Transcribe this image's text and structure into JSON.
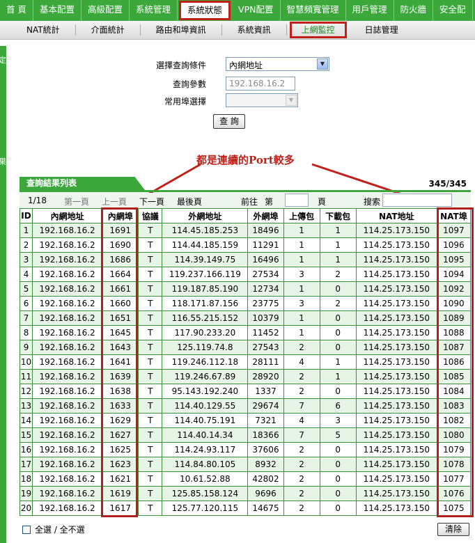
{
  "topnav": [
    "首 頁",
    "基本配置",
    "高級配置",
    "系統管理",
    "系統狀態",
    "VPN配置",
    "智慧頻寬管理",
    "用戶管理",
    "防火牆",
    "安全配"
  ],
  "subnav": [
    "NAT統計",
    "介面統計",
    "路由和埠資訊",
    "系統資訊",
    "上網監控",
    "日誌管理"
  ],
  "leftbar": {
    "top_char": "定",
    "mid_char": "果"
  },
  "query": {
    "cond_label": "選擇查詢條件",
    "cond_value": "內網地址",
    "param_label": "查詢參數",
    "param_value": "192.168.16.2",
    "port_label": "常用埠選擇",
    "port_value": "",
    "button": "查 詢"
  },
  "annotation": "都是連續的Port較多",
  "results": {
    "title": "查詢結果列表",
    "count": "345/345",
    "pager": {
      "page": "1/18",
      "first": "第一頁",
      "prev": "上一頁",
      "next": "下一頁",
      "last": "最後頁",
      "goto": "前往",
      "di": "第",
      "ye": "頁",
      "search": "搜索"
    },
    "columns": [
      "ID",
      "內網地址",
      "內網埠",
      "協議",
      "外網地址",
      "外網埠",
      "上傳包",
      "下載包",
      "NAT地址",
      "NAT埠"
    ],
    "rows": [
      [
        "1",
        "192.168.16.2",
        "1691",
        "T",
        "114.45.185.253",
        "18496",
        "1",
        "1",
        "114.25.173.150",
        "1097"
      ],
      [
        "2",
        "192.168.16.2",
        "1690",
        "T",
        "114.44.185.159",
        "11291",
        "1",
        "1",
        "114.25.173.150",
        "1096"
      ],
      [
        "3",
        "192.168.16.2",
        "1686",
        "T",
        "114.39.149.75",
        "16496",
        "1",
        "1",
        "114.25.173.150",
        "1095"
      ],
      [
        "4",
        "192.168.16.2",
        "1664",
        "T",
        "119.237.166.119",
        "27534",
        "3",
        "2",
        "114.25.173.150",
        "1094"
      ],
      [
        "5",
        "192.168.16.2",
        "1661",
        "T",
        "119.187.85.190",
        "12734",
        "1",
        "0",
        "114.25.173.150",
        "1092"
      ],
      [
        "6",
        "192.168.16.2",
        "1660",
        "T",
        "118.171.87.156",
        "23775",
        "3",
        "2",
        "114.25.173.150",
        "1090"
      ],
      [
        "7",
        "192.168.16.2",
        "1651",
        "T",
        "116.55.215.152",
        "10379",
        "1",
        "0",
        "114.25.173.150",
        "1089"
      ],
      [
        "8",
        "192.168.16.2",
        "1645",
        "T",
        "117.90.233.20",
        "11452",
        "1",
        "0",
        "114.25.173.150",
        "1088"
      ],
      [
        "9",
        "192.168.16.2",
        "1643",
        "T",
        "125.119.74.8",
        "27543",
        "2",
        "0",
        "114.25.173.150",
        "1087"
      ],
      [
        "10",
        "192.168.16.2",
        "1641",
        "T",
        "119.246.112.18",
        "28111",
        "4",
        "1",
        "114.25.173.150",
        "1086"
      ],
      [
        "11",
        "192.168.16.2",
        "1639",
        "T",
        "119.246.67.89",
        "28920",
        "2",
        "1",
        "114.25.173.150",
        "1085"
      ],
      [
        "12",
        "192.168.16.2",
        "1638",
        "T",
        "95.143.192.240",
        "1337",
        "2",
        "0",
        "114.25.173.150",
        "1084"
      ],
      [
        "13",
        "192.168.16.2",
        "1633",
        "T",
        "114.40.129.55",
        "29674",
        "7",
        "6",
        "114.25.173.150",
        "1083"
      ],
      [
        "14",
        "192.168.16.2",
        "1629",
        "T",
        "114.40.75.191",
        "7321",
        "4",
        "3",
        "114.25.173.150",
        "1082"
      ],
      [
        "15",
        "192.168.16.2",
        "1627",
        "T",
        "114.40.14.34",
        "18366",
        "7",
        "5",
        "114.25.173.150",
        "1080"
      ],
      [
        "16",
        "192.168.16.2",
        "1625",
        "T",
        "114.24.93.117",
        "37606",
        "2",
        "0",
        "114.25.173.150",
        "1079"
      ],
      [
        "17",
        "192.168.16.2",
        "1623",
        "T",
        "114.84.80.105",
        "8932",
        "2",
        "0",
        "114.25.173.150",
        "1078"
      ],
      [
        "18",
        "192.168.16.2",
        "1621",
        "T",
        "10.61.52.88",
        "42802",
        "2",
        "0",
        "114.25.173.150",
        "1077"
      ],
      [
        "19",
        "192.168.16.2",
        "1619",
        "T",
        "125.85.158.124",
        "9696",
        "2",
        "0",
        "114.25.173.150",
        "1076"
      ],
      [
        "20",
        "192.168.16.2",
        "1617",
        "T",
        "125.77.120.115",
        "14675",
        "2",
        "0",
        "114.25.173.150",
        "1075"
      ]
    ]
  },
  "bottom": {
    "select_all": "全選 / 全不選",
    "clear": "清除"
  },
  "colors": {
    "green": "#3ca83c",
    "highlight_red": "#c0221b",
    "row_alt": "#e6f5e6"
  }
}
